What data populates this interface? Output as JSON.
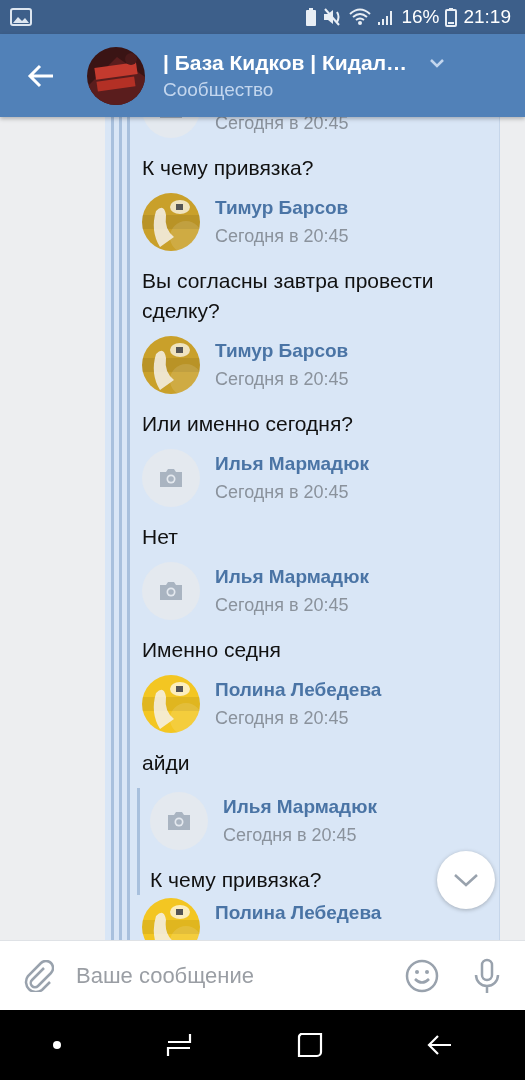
{
  "status_bar": {
    "battery": "16%",
    "time": "21:19"
  },
  "header": {
    "title": "| База Кидков | Кидал…",
    "subtitle": "Сообщество"
  },
  "messages": [
    {
      "kind": "author",
      "avatar": {
        "kind": "camera"
      },
      "time": "Сегодня в 20:45"
    },
    {
      "kind": "text",
      "text": "К чему привязка?"
    },
    {
      "kind": "author",
      "name": "Тимур Барсов",
      "time": "Сегодня в 20:45"
    },
    {
      "kind": "text",
      "text": "Вы согласны завтра провести сделку?"
    },
    {
      "kind": "author",
      "name": "Тимур Барсов",
      "time": "Сегодня в 20:45"
    },
    {
      "kind": "text",
      "text": "Или именно сегодня?"
    },
    {
      "kind": "author",
      "avatar": {
        "kind": "camera"
      },
      "name": "Илья Мармадюк",
      "time": "Сегодня в 20:45"
    },
    {
      "kind": "text",
      "text": "Нет"
    },
    {
      "kind": "author",
      "avatar": {
        "kind": "camera"
      },
      "name": "Илья Мармадюк",
      "time": "Сегодня в 20:45"
    },
    {
      "kind": "text",
      "text": "Именно седня"
    },
    {
      "kind": "author",
      "name": "Полина Лебедева",
      "time": "Сегодня в 20:45"
    },
    {
      "kind": "text",
      "text": "айди"
    },
    {
      "kind": "quote",
      "items": [
        {
          "kind": "author",
          "avatar": {
            "kind": "camera"
          },
          "name": "Илья Мармадюк",
          "time": "Сегодня в 20:45"
        },
        {
          "kind": "text",
          "text": "К чему привязка?"
        }
      ]
    },
    {
      "kind": "author",
      "name": "Полина Лебедева"
    }
  ],
  "composer": {
    "placeholder": "Ваше сообщение"
  }
}
